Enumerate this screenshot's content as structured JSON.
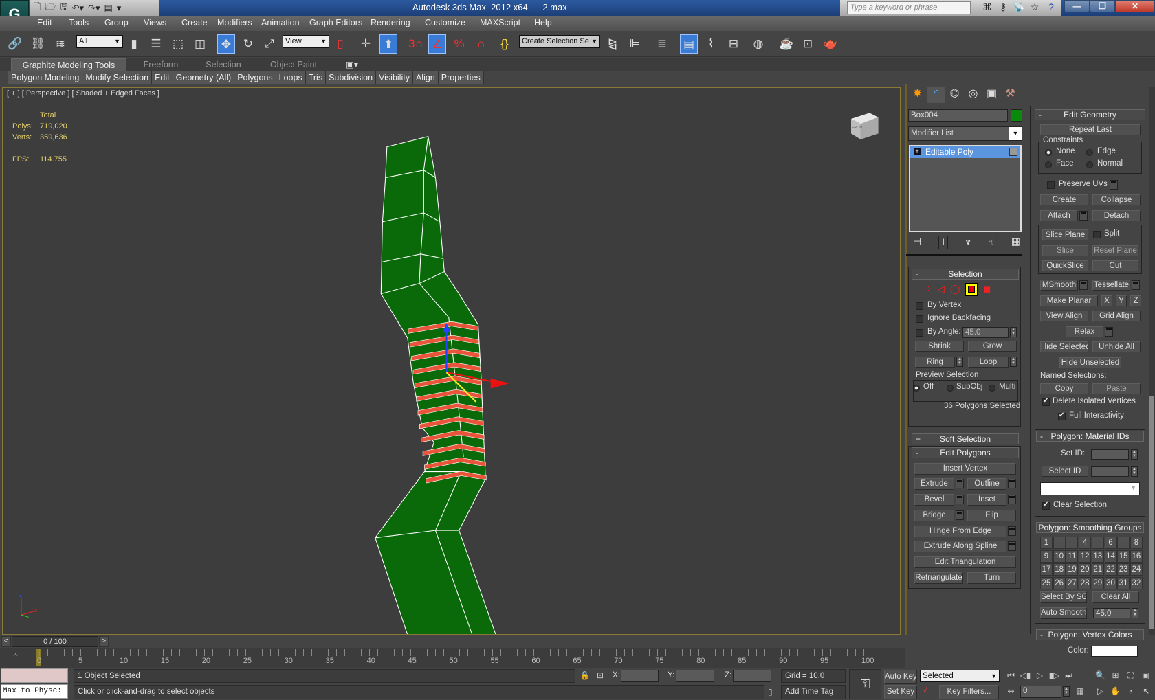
{
  "window": {
    "title": "Autodesk 3ds Max  2012 x64      2.max",
    "logo": "3ds-max-logo",
    "search_placeholder": "Type a keyword or phrase",
    "minimize": "—",
    "restore": "❐",
    "close": "✕"
  },
  "quick_access": [
    "new-icon",
    "open-icon",
    "save-icon",
    "undo-icon",
    "redo-icon",
    "project-folder-icon"
  ],
  "info_icons": [
    "binoculars-icon",
    "key-icon",
    "satellite-icon",
    "star-icon",
    "help-icon"
  ],
  "menu": [
    "Edit",
    "Tools",
    "Group",
    "Views",
    "Create",
    "Modifiers",
    "Animation",
    "Graph Editors",
    "Rendering",
    "Customize",
    "MAXScript",
    "Help"
  ],
  "toolbar": {
    "selection_filter": "All",
    "reference_coord": "View",
    "named_selection": "Create Selection Se"
  },
  "ribbon": {
    "tabs": [
      "Graphite Modeling Tools",
      "Freeform",
      "Selection",
      "Object Paint"
    ],
    "active_tab": "Graphite Modeling Tools",
    "panels": [
      "Polygon Modeling",
      "Modify Selection",
      "Edit",
      "Geometry (All)",
      "Polygons",
      "Loops",
      "Tris",
      "Subdivision",
      "Visibility",
      "Align",
      "Properties"
    ]
  },
  "viewport": {
    "label": "[ + ] [ Perspective ] [ Shaded + Edged Faces ]",
    "stats": {
      "header": "Total",
      "polys_label": "Polys:",
      "polys": "719,020",
      "verts_label": "Verts:",
      "verts": "359,636",
      "fps_label": "FPS:",
      "fps": "114.755"
    },
    "viewcube_label": "FRONT",
    "object_color": "#0a6a0a",
    "selection_color": "#e8553a"
  },
  "command_panel": {
    "object_name": "Box004",
    "object_color": "#0a8a0a",
    "modifier_list": "Modifier List",
    "stack": [
      "Editable Poly"
    ],
    "selection": {
      "title": "Selection",
      "by_vertex": "By Vertex",
      "ignore_backfacing": "Ignore Backfacing",
      "by_angle": "By Angle:",
      "angle": "45.0",
      "shrink": "Shrink",
      "grow": "Grow",
      "ring": "Ring",
      "loop": "Loop",
      "preview": "Preview Selection",
      "off": "Off",
      "subobj": "SubObj",
      "multi": "Multi",
      "status": "36 Polygons Selected"
    },
    "soft_selection": "Soft Selection",
    "edit_polygons": {
      "title": "Edit Polygons",
      "insert_vertex": "Insert Vertex",
      "extrude": "Extrude",
      "outline": "Outline",
      "bevel": "Bevel",
      "inset": "Inset",
      "bridge": "Bridge",
      "flip": "Flip",
      "hinge": "Hinge From Edge",
      "extrude_spline": "Extrude Along Spline",
      "edit_tri": "Edit Triangulation",
      "retriangulate": "Retriangulate",
      "turn": "Turn"
    },
    "edit_geometry": {
      "title": "Edit Geometry",
      "repeat_last": "Repeat Last",
      "constraints": "Constraints",
      "none": "None",
      "edge": "Edge",
      "face": "Face",
      "normal": "Normal",
      "preserve_uvs": "Preserve UVs",
      "create": "Create",
      "collapse": "Collapse",
      "attach": "Attach",
      "detach": "Detach",
      "slice_plane": "Slice Plane",
      "split": "Split",
      "slice": "Slice",
      "reset_plane": "Reset Plane",
      "quickslice": "QuickSlice",
      "cut": "Cut",
      "msmooth": "MSmooth",
      "tessellate": "Tessellate",
      "make_planar": "Make Planar",
      "x": "X",
      "y": "Y",
      "z": "Z",
      "view_align": "View Align",
      "grid_align": "Grid Align",
      "relax": "Relax",
      "hide_selected": "Hide Selected",
      "unhide_all": "Unhide All",
      "hide_unselected": "Hide Unselected",
      "named_selections": "Named Selections:",
      "copy": "Copy",
      "paste": "Paste",
      "delete_isolated": "Delete Isolated Vertices",
      "full_interactivity": "Full Interactivity"
    },
    "material_ids": {
      "title": "Polygon: Material IDs",
      "set_id": "Set ID:",
      "select_id": "Select ID",
      "clear_selection": "Clear Selection"
    },
    "smoothing": {
      "title": "Polygon: Smoothing Groups",
      "groups": [
        "1",
        "",
        "",
        "4",
        "",
        "6",
        "",
        "8",
        "9",
        "10",
        "11",
        "12",
        "13",
        "14",
        "15",
        "16",
        "17",
        "18",
        "19",
        "20",
        "21",
        "22",
        "23",
        "24",
        "25",
        "26",
        "27",
        "28",
        "29",
        "30",
        "31",
        "32"
      ],
      "select_by_sg": "Select By SG",
      "clear_all": "Clear All",
      "auto_smooth": "Auto Smooth",
      "threshold": "45.0"
    },
    "vertex_colors": {
      "title": "Polygon: Vertex Colors",
      "color": "Color:"
    }
  },
  "timeline": {
    "frame": "0 / 100",
    "prev": "<",
    "next": ">",
    "ticks": [
      "0",
      "5",
      "10",
      "15",
      "20",
      "25",
      "30",
      "35",
      "40",
      "45",
      "50",
      "55",
      "60",
      "65",
      "70",
      "75",
      "80",
      "85",
      "90",
      "95",
      "100"
    ]
  },
  "status": {
    "script_listener": "Max to Physc:",
    "selection": "1 Object Selected",
    "prompt": "Click or click-and-drag to select objects",
    "x_label": "X:",
    "y_label": "Y:",
    "z_label": "Z:",
    "grid": "Grid = 10.0",
    "add_time_tag": "Add Time Tag",
    "auto_key": "Auto Key",
    "set_key": "Set Key",
    "key_mode": "Selected",
    "key_filters": "Key Filters...",
    "current_frame": "0"
  }
}
